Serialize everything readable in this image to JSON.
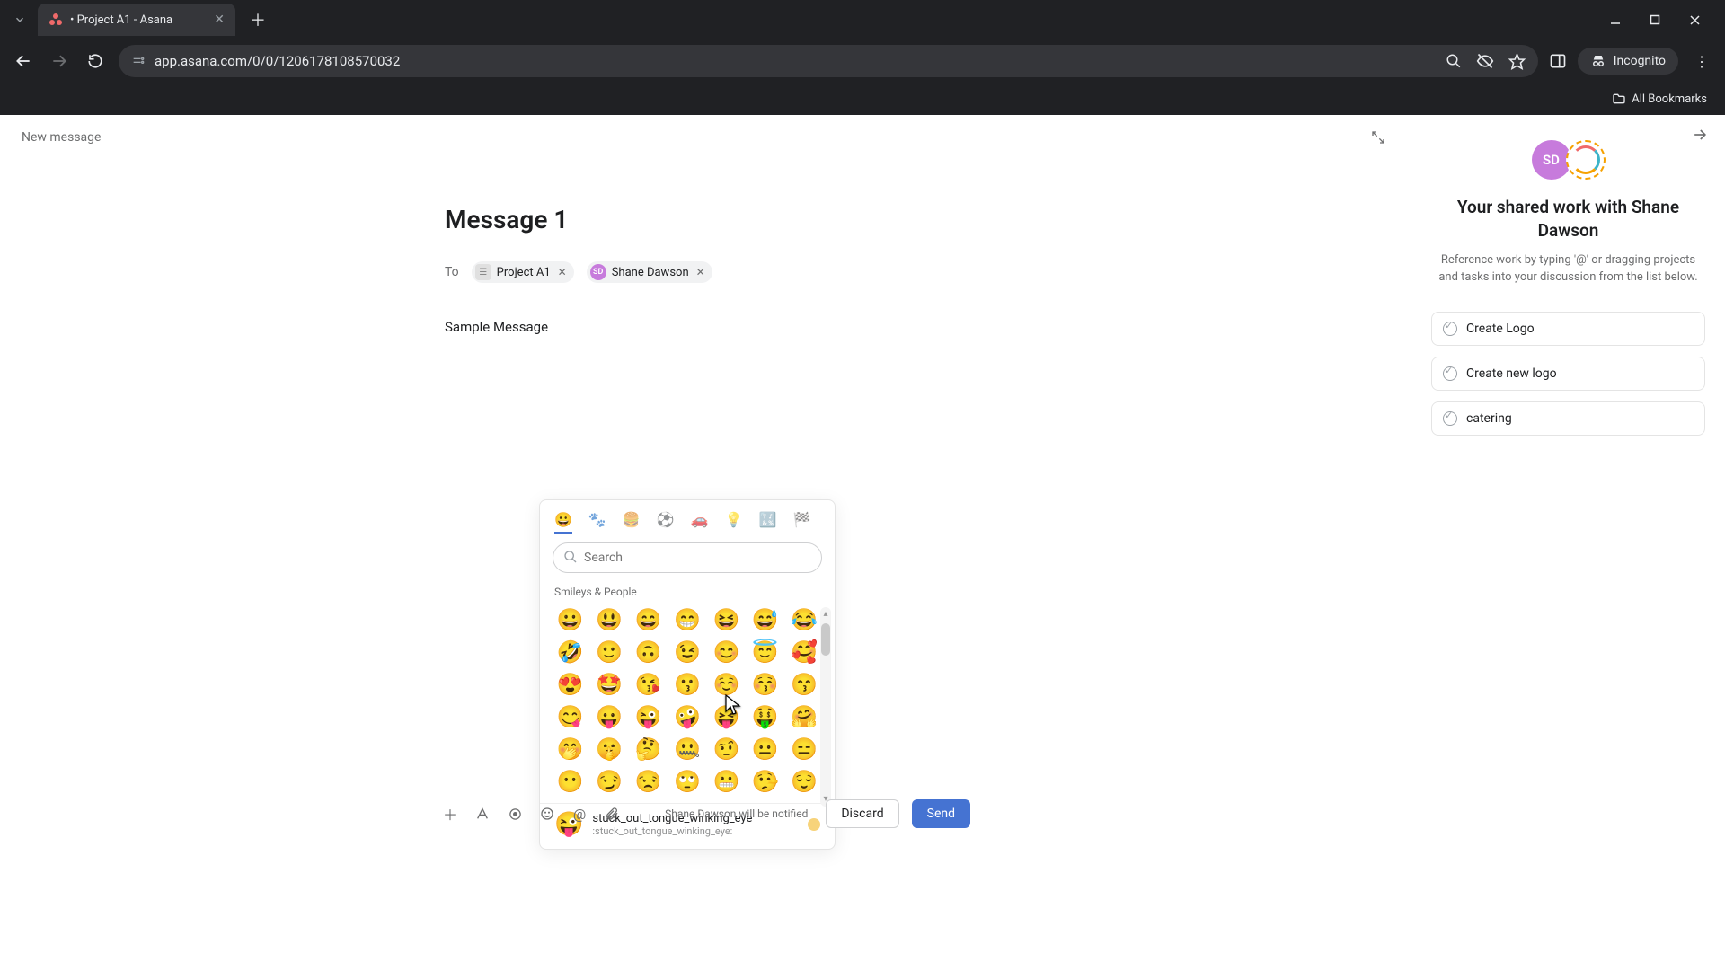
{
  "browser": {
    "tab_title": "• Project A1 - Asana",
    "url": "app.asana.com/0/0/1206178108570032",
    "incognito_label": "Incognito",
    "all_bookmarks": "All Bookmarks"
  },
  "header": {
    "new_message": "New message"
  },
  "compose": {
    "title": "Message 1",
    "to_label": "To",
    "recipients": [
      {
        "kind": "project",
        "label": "Project A1"
      },
      {
        "kind": "person",
        "label": "Shane Dawson",
        "initials": "SD"
      }
    ],
    "body": "Sample Message"
  },
  "emoji_picker": {
    "search_placeholder": "Search",
    "section_label": "Smileys & People",
    "category_icons": [
      "😀",
      "🐾",
      "🍔",
      "⚽",
      "🚗",
      "💡",
      "🔣",
      "🏁"
    ],
    "grid": [
      "😀",
      "😃",
      "😄",
      "😁",
      "😆",
      "😅",
      "😂",
      "🤣",
      "🙂",
      "🙃",
      "😉",
      "😊",
      "😇",
      "🥰",
      "😍",
      "🤩",
      "😘",
      "😗",
      "☺️",
      "😚",
      "😙",
      "😋",
      "😛",
      "😜",
      "🤪",
      "😝",
      "🤑",
      "🤗",
      "🤭",
      "🤫",
      "🤔",
      "🤐",
      "🤨",
      "😐",
      "😑",
      "😶",
      "😏",
      "😒",
      "🙄",
      "😬",
      "🤥",
      "😌"
    ],
    "preview": {
      "emoji": "😜",
      "name": "stuck_out_tongue_winking_eye",
      "code": ":stuck_out_tongue_winking_eye:"
    }
  },
  "actions": {
    "notify_text": "Shane Dawson will be notified",
    "discard": "Discard",
    "send": "Send"
  },
  "sidebar": {
    "avatar_initials": "SD",
    "title": "Your shared work with Shane Dawson",
    "subtitle": "Reference work by typing '@' or dragging projects and tasks into your discussion from the list below.",
    "tasks": [
      "Create Logo",
      "Create new logo",
      "catering"
    ]
  }
}
